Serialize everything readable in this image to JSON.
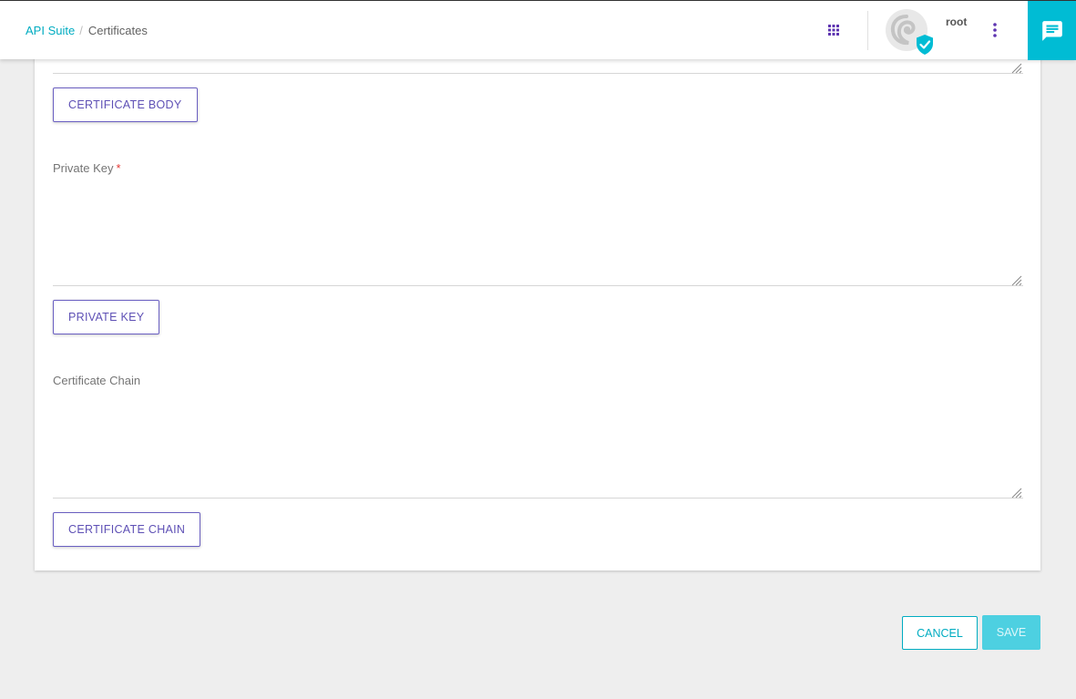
{
  "breadcrumb": {
    "root_link": "API Suite",
    "separator": "/",
    "current": "Certificates"
  },
  "header": {
    "username": "root",
    "apps_icon": "apps-grid-icon",
    "menu_icon": "more-vert-icon",
    "chat_icon": "chat-icon",
    "avatar_badge_icon": "verified-shield-icon"
  },
  "form": {
    "body_button": "CERTIFICATE BODY",
    "private_key": {
      "label": "Private Key",
      "required_mark": "*",
      "value": ""
    },
    "private_key_button": "PRIVATE KEY",
    "chain": {
      "label": "Certificate Chain",
      "value": ""
    },
    "chain_button": "CERTIFICATE CHAIN"
  },
  "actions": {
    "cancel": "CANCEL",
    "save": "SAVE"
  },
  "colors": {
    "accent": "#00bcd4",
    "primary": "#5e50b5",
    "required": "#e53935"
  }
}
